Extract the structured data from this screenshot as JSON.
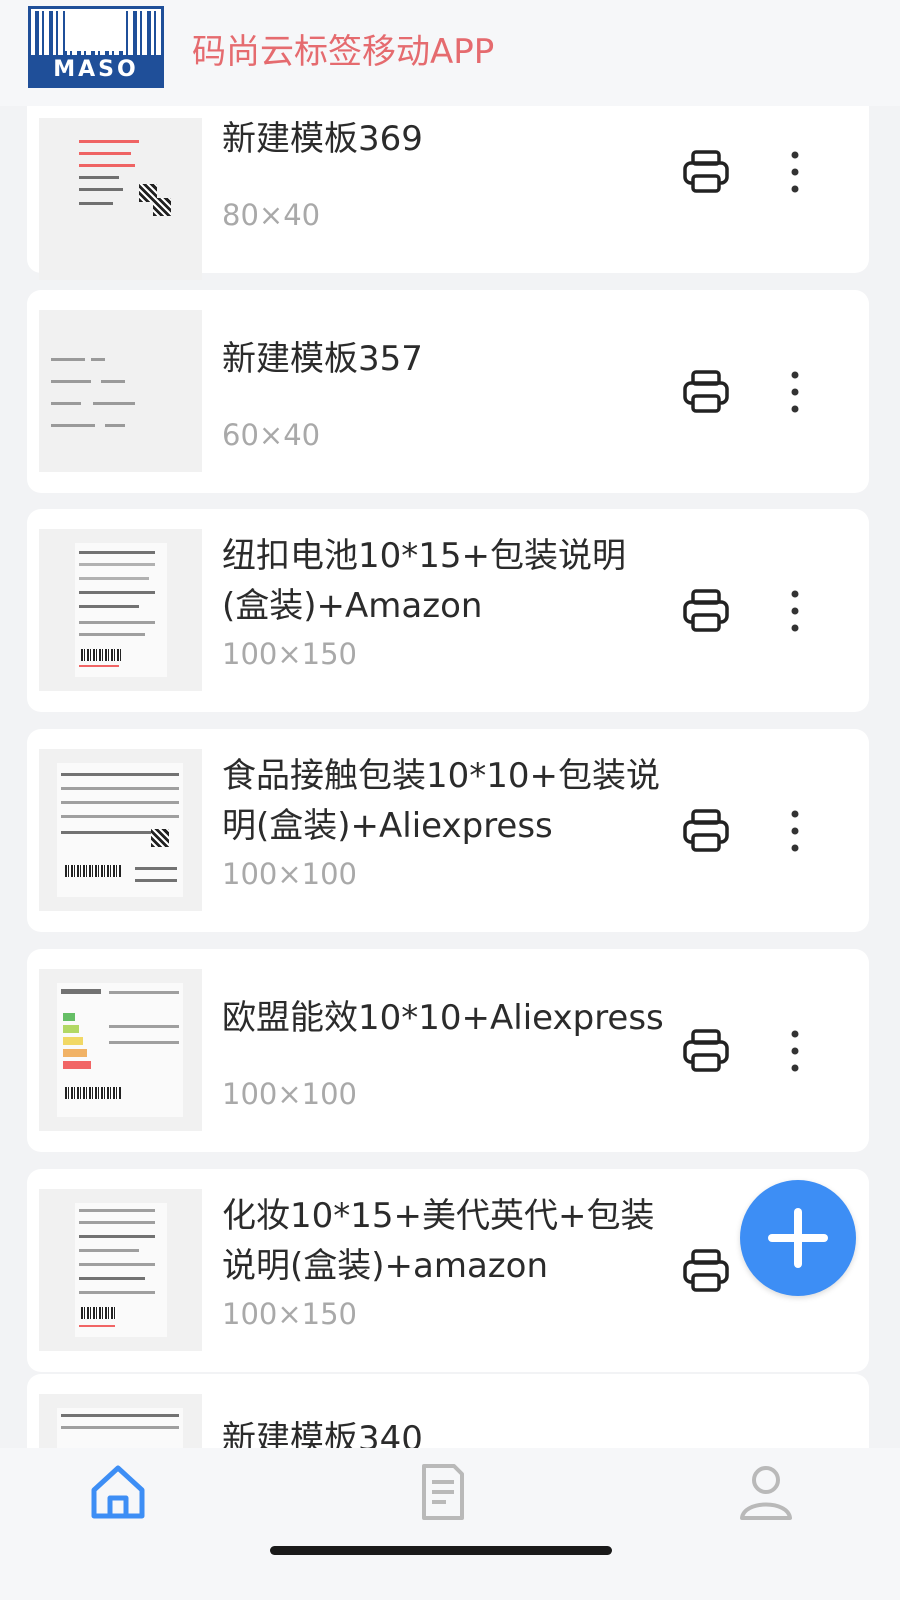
{
  "app": {
    "logo_text": "MASO",
    "title": "码尚云标签移动APP"
  },
  "templates": [
    {
      "name": "新建模板369",
      "size": "80×40"
    },
    {
      "name": "新建模板357",
      "size": "60×40"
    },
    {
      "name": "纽扣电池10*15+包装说明(盒装)+Amazon",
      "size": "100×150"
    },
    {
      "name": "食品接触包装10*10+包装说明(盒装)+Aliexpress",
      "size": "100×100"
    },
    {
      "name": "欧盟能效10*10+Aliexpress",
      "size": "100×100"
    },
    {
      "name": "化妆10*15+美代英代+包装说明(盒装)+amazon",
      "size": "100×150"
    },
    {
      "name": "新建模板340",
      "size": ""
    }
  ],
  "tabs": [
    {
      "name": "home-icon",
      "active": true
    },
    {
      "name": "document-icon",
      "active": false
    },
    {
      "name": "user-icon",
      "active": false
    }
  ],
  "colors": {
    "accent": "#3d8ef5",
    "title": "#e56b6f",
    "logo": "#1f4f99"
  }
}
